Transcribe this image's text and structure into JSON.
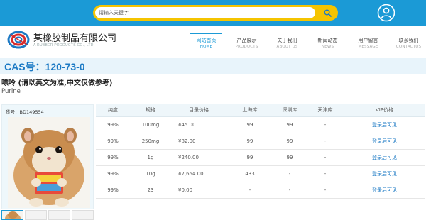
{
  "search": {
    "placeholder": "请输入关键字"
  },
  "company": {
    "name": "某橡胶制品有限公司",
    "name_en": "A RUBBER PRODUCTS CO., LTD"
  },
  "nav": [
    {
      "cn": "网站首页",
      "en": "HOME",
      "active": true
    },
    {
      "cn": "产品展示",
      "en": "PRODUCTS"
    },
    {
      "cn": "关于我们",
      "en": "ABOUT US"
    },
    {
      "cn": "新闻动态",
      "en": "NEWS"
    },
    {
      "cn": "用户留言",
      "en": "MESSAGE"
    },
    {
      "cn": "联系我们",
      "en": "CONTACTUS"
    }
  ],
  "product": {
    "cas": "CAS号：120-73-0",
    "cn_name": "嘌呤 (请以英文为准,中文仅做参考)",
    "en_name": "Purine",
    "code": "货号：BD149554"
  },
  "table": {
    "headers": [
      "纯度",
      "规格",
      "目录价格",
      "上海库",
      "深圳库",
      "天津库",
      "VIP价格"
    ],
    "rows": [
      [
        "99%",
        "100mg",
        "¥45.00",
        "99",
        "99",
        "-",
        "登录后可见"
      ],
      [
        "99%",
        "250mg",
        "¥82.00",
        "99",
        "99",
        "-",
        "登录后可见"
      ],
      [
        "99%",
        "1g",
        "¥240.00",
        "99",
        "99",
        "-",
        "登录后可见"
      ],
      [
        "99%",
        "10g",
        "¥7,654.00",
        "433",
        "-",
        "-",
        "登录后可见"
      ],
      [
        "99%",
        "23",
        "¥0.00",
        "-",
        "-",
        "-",
        "登录后可见"
      ]
    ]
  },
  "colors": {
    "brand": "#1b9ad6",
    "accent": "#f5c400",
    "link": "#1b79c4"
  },
  "icons": {
    "search": "search-icon",
    "user": "user-icon",
    "logo": "logo-icon"
  }
}
